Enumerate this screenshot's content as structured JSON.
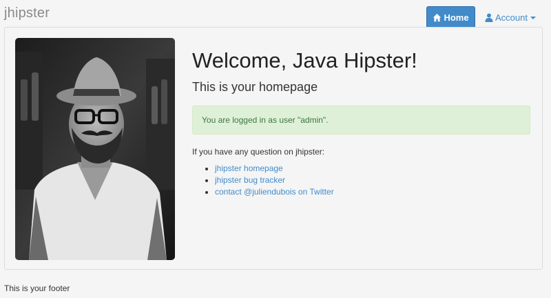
{
  "navbar": {
    "brand": "jhipster",
    "home_label": "Home",
    "account_label": "Account"
  },
  "icons": {
    "home": "home-icon",
    "user": "user-icon",
    "caret": "caret-down-icon"
  },
  "main": {
    "title": "Welcome, Java Hipster!",
    "subtitle": "This is your homepage",
    "alert": "You are logged in as user \"admin\".",
    "question": "If you have any question on jhipster:",
    "links": [
      "jhipster homepage",
      "jhipster bug tracker",
      "contact @juliendubois on Twitter"
    ]
  },
  "footer": "This is your footer",
  "colors": {
    "primary": "#428bca",
    "success_bg": "#dff0d8",
    "success_text": "#3c763d"
  }
}
